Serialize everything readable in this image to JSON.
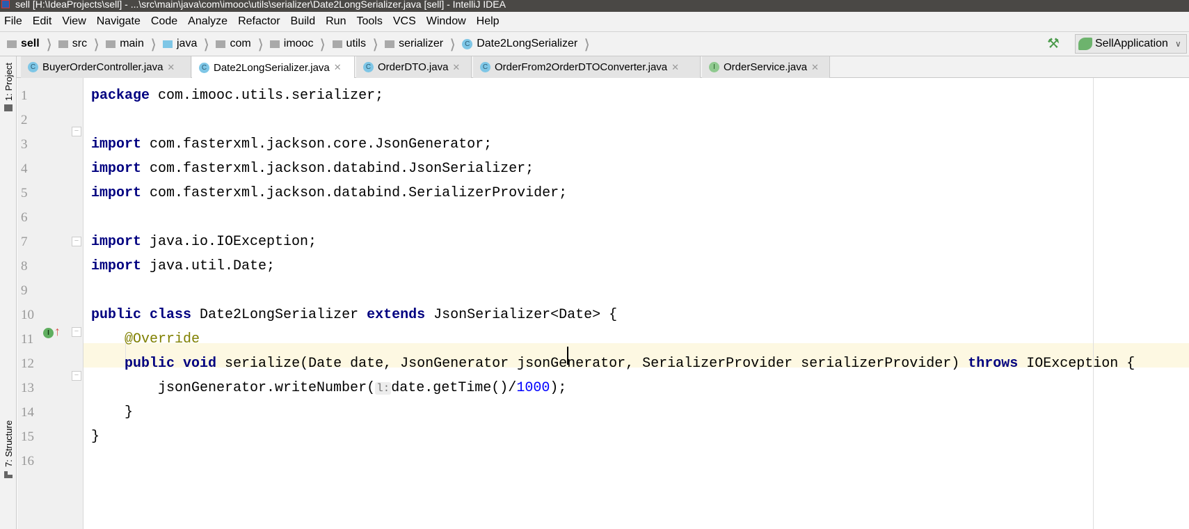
{
  "window": {
    "title": "sell [H:\\IdeaProjects\\sell] - ...\\src\\main\\java\\com\\imooc\\utils\\serializer\\Date2LongSerializer.java [sell] - IntelliJ IDEA"
  },
  "menu": [
    "File",
    "Edit",
    "View",
    "Navigate",
    "Code",
    "Analyze",
    "Refactor",
    "Build",
    "Run",
    "Tools",
    "VCS",
    "Window",
    "Help"
  ],
  "breadcrumb": [
    {
      "label": "sell",
      "icon": "module-folder"
    },
    {
      "label": "src",
      "icon": "folder"
    },
    {
      "label": "main",
      "icon": "folder"
    },
    {
      "label": "java",
      "icon": "source-folder"
    },
    {
      "label": "com",
      "icon": "package"
    },
    {
      "label": "imooc",
      "icon": "package"
    },
    {
      "label": "utils",
      "icon": "package"
    },
    {
      "label": "serializer",
      "icon": "package"
    },
    {
      "label": "Date2LongSerializer",
      "icon": "class"
    }
  ],
  "run_config": {
    "label": "SellApplication"
  },
  "side_tools": {
    "project": "1: Project",
    "structure": "7: Structure"
  },
  "tabs": [
    {
      "label": "BuyerOrderController.java",
      "icon": "C",
      "active": false
    },
    {
      "label": "Date2LongSerializer.java",
      "icon": "C",
      "active": true
    },
    {
      "label": "OrderDTO.java",
      "icon": "C",
      "active": false
    },
    {
      "label": "OrderFrom2OrderDTOConverter.java",
      "icon": "C",
      "active": false
    },
    {
      "label": "OrderService.java",
      "icon": "I",
      "active": false
    }
  ],
  "editor": {
    "current_line": 13,
    "lines": [
      [
        [
          "package",
          "kw"
        ],
        [
          " com.imooc.utils.serializer;",
          ""
        ]
      ],
      [],
      [
        [
          "import",
          "kw"
        ],
        [
          " com.fasterxml.jackson.core.JsonGenerator;",
          ""
        ]
      ],
      [
        [
          "import",
          "kw"
        ],
        [
          " com.fasterxml.jackson.databind.JsonSerializer;",
          ""
        ]
      ],
      [
        [
          "import",
          "kw"
        ],
        [
          " com.fasterxml.jackson.databind.SerializerProvider;",
          ""
        ]
      ],
      [],
      [
        [
          "import",
          "kw"
        ],
        [
          " java.io.IOException;",
          ""
        ]
      ],
      [
        [
          "import",
          "kw"
        ],
        [
          " java.util.Date;",
          ""
        ]
      ],
      [],
      [
        [
          "public class",
          "kw"
        ],
        [
          " Date2LongSerializer ",
          ""
        ],
        [
          "extends",
          "kw"
        ],
        [
          " JsonSerializer<Date> {",
          ""
        ]
      ],
      [
        [
          "    ",
          ""
        ],
        [
          "@Override",
          "an"
        ]
      ],
      [
        [
          "    ",
          ""
        ],
        [
          "public void",
          "kw"
        ],
        [
          " serialize(Date date, JsonGenerator jsonGenerator, SerializerProvider serializerProvider) ",
          ""
        ],
        [
          "throws",
          "kw"
        ],
        [
          " IOException {",
          ""
        ]
      ],
      [
        [
          "        jsonGenerator.writeNumber(",
          ""
        ],
        [
          "l:",
          "hint"
        ],
        [
          "date.getTime()/",
          ""
        ],
        [
          "1000",
          "num"
        ],
        [
          ");",
          ""
        ]
      ],
      [
        [
          "    }",
          ""
        ]
      ],
      [
        [
          "}",
          ""
        ]
      ],
      []
    ]
  }
}
